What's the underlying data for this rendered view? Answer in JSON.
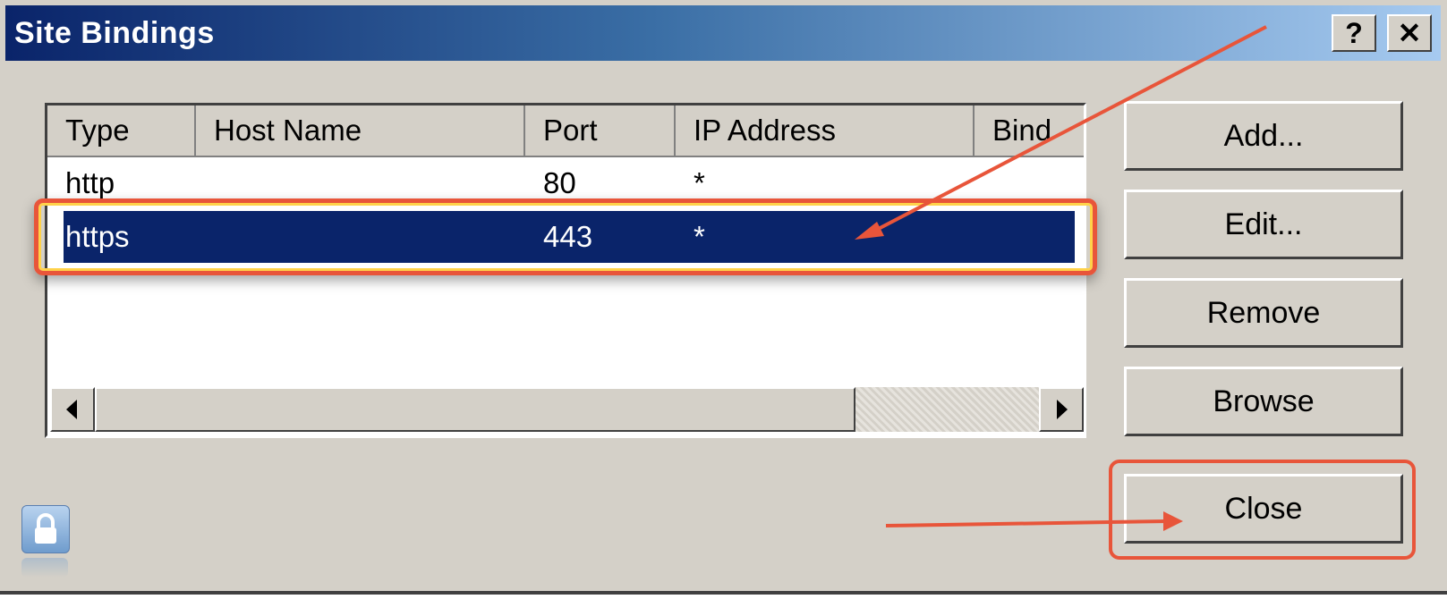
{
  "window": {
    "title": "Site Bindings",
    "help_label": "?",
    "close_label": "✕"
  },
  "table": {
    "columns": [
      "Type",
      "Host Name",
      "Port",
      "IP Address",
      "Bind"
    ],
    "rows": [
      {
        "type": "http",
        "host": "",
        "port": "80",
        "ip": "*"
      },
      {
        "type": "https",
        "host": "",
        "port": "443",
        "ip": "*",
        "selected": true
      }
    ]
  },
  "buttons": {
    "add": "Add...",
    "edit": "Edit...",
    "remove": "Remove",
    "browse": "Browse",
    "close": "Close"
  },
  "colors": {
    "selection": "#0a246a",
    "annotation": "#e8553a",
    "dialog_bg": "#d4d0c8"
  },
  "icons": {
    "lock": "lock-icon",
    "scroll_left": "scroll-left-arrow-icon",
    "scroll_right": "scroll-right-arrow-icon"
  }
}
